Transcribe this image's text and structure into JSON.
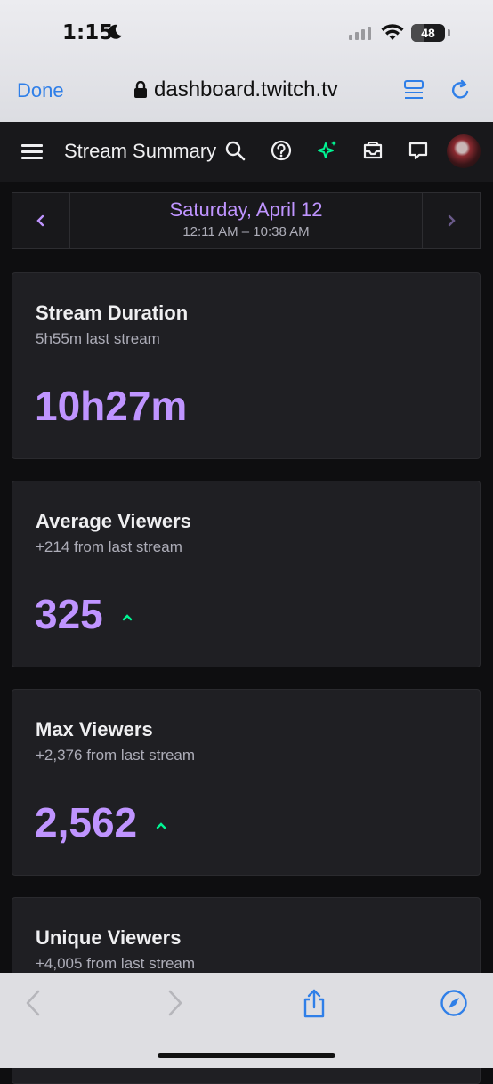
{
  "status": {
    "time": "1:15",
    "battery": "48"
  },
  "safari": {
    "done_label": "Done",
    "url": "dashboard.twitch.tv"
  },
  "nav": {
    "title": "Stream Summary"
  },
  "date": {
    "title": "Saturday, April 12",
    "range": "12:11 AM – 10:38 AM"
  },
  "cards": [
    {
      "title": "Stream Duration",
      "subtitle": "5h55m last stream",
      "value": "10h27m",
      "trend": "none"
    },
    {
      "title": "Average Viewers",
      "subtitle": "+214 from last stream",
      "value": "325",
      "trend": "up"
    },
    {
      "title": "Max Viewers",
      "subtitle": "+2,376 from last stream",
      "value": "2,562",
      "trend": "up"
    },
    {
      "title": "Unique Viewers",
      "subtitle": "+4,005 from last stream",
      "value": "",
      "trend": "none"
    }
  ],
  "colors": {
    "accent": "#bf94ff",
    "trend_up": "#00f593",
    "background": "#0e0e10",
    "card": "#1f1f23"
  },
  "icons": [
    "menu-icon",
    "search-icon",
    "help-icon",
    "sparkle-icon",
    "inbox-icon",
    "chat-icon",
    "lock-icon",
    "reader-icon",
    "reload-icon",
    "back-icon",
    "forward-icon",
    "share-icon",
    "compass-icon"
  ]
}
